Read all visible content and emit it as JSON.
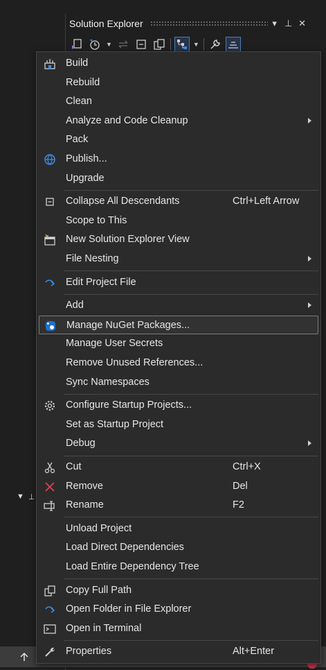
{
  "solution_explorer": {
    "title": "Solution Explorer",
    "controls": [
      "▾",
      "⊥",
      "✕"
    ]
  },
  "context_menu": {
    "groups": [
      [
        {
          "label": "Build",
          "icon": "build-icon",
          "shortcut": "",
          "submenu": false
        },
        {
          "label": "Rebuild",
          "icon": "",
          "shortcut": "",
          "submenu": false
        },
        {
          "label": "Clean",
          "icon": "",
          "shortcut": "",
          "submenu": false
        },
        {
          "label": "Analyze and Code Cleanup",
          "icon": "",
          "shortcut": "",
          "submenu": true
        },
        {
          "label": "Pack",
          "icon": "",
          "shortcut": "",
          "submenu": false
        },
        {
          "label": "Publish...",
          "icon": "globe-icon",
          "shortcut": "",
          "submenu": false
        },
        {
          "label": "Upgrade",
          "icon": "",
          "shortcut": "",
          "submenu": false
        }
      ],
      [
        {
          "label": "Collapse All Descendants",
          "icon": "collapse-icon",
          "shortcut": "Ctrl+Left Arrow",
          "submenu": false
        },
        {
          "label": "Scope to This",
          "icon": "",
          "shortcut": "",
          "submenu": false
        },
        {
          "label": "New Solution Explorer View",
          "icon": "new-view-icon",
          "shortcut": "",
          "submenu": false
        },
        {
          "label": "File Nesting",
          "icon": "",
          "shortcut": "",
          "submenu": true
        }
      ],
      [
        {
          "label": "Edit Project File",
          "icon": "redo-arrow-icon",
          "shortcut": "",
          "submenu": false
        }
      ],
      [
        {
          "label": "Add",
          "icon": "",
          "shortcut": "",
          "submenu": true
        },
        {
          "label": "Manage NuGet Packages...",
          "icon": "nuget-icon",
          "shortcut": "",
          "submenu": false,
          "highlighted": true
        },
        {
          "label": "Manage User Secrets",
          "icon": "",
          "shortcut": "",
          "submenu": false
        },
        {
          "label": "Remove Unused References...",
          "icon": "",
          "shortcut": "",
          "submenu": false
        },
        {
          "label": "Sync Namespaces",
          "icon": "",
          "shortcut": "",
          "submenu": false
        }
      ],
      [
        {
          "label": "Configure Startup Projects...",
          "icon": "gear-icon",
          "shortcut": "",
          "submenu": false
        },
        {
          "label": "Set as Startup Project",
          "icon": "",
          "shortcut": "",
          "submenu": false
        },
        {
          "label": "Debug",
          "icon": "",
          "shortcut": "",
          "submenu": true
        }
      ],
      [
        {
          "label": "Cut",
          "icon": "scissors-icon",
          "shortcut": "Ctrl+X",
          "submenu": false
        },
        {
          "label": "Remove",
          "icon": "close-icon",
          "shortcut": "Del",
          "submenu": false
        },
        {
          "label": "Rename",
          "icon": "rename-icon",
          "shortcut": "F2",
          "submenu": false
        }
      ],
      [
        {
          "label": "Unload Project",
          "icon": "",
          "shortcut": "",
          "submenu": false
        },
        {
          "label": "Load Direct Dependencies",
          "icon": "",
          "shortcut": "",
          "submenu": false
        },
        {
          "label": "Load Entire Dependency Tree",
          "icon": "",
          "shortcut": "",
          "submenu": false
        }
      ],
      [
        {
          "label": "Copy Full Path",
          "icon": "copy-icon",
          "shortcut": "",
          "submenu": false
        },
        {
          "label": "Open Folder in File Explorer",
          "icon": "redo-arrow-icon",
          "shortcut": "",
          "submenu": false
        },
        {
          "label": "Open in Terminal",
          "icon": "terminal-icon",
          "shortcut": "",
          "submenu": false
        }
      ],
      [
        {
          "label": "Properties",
          "icon": "wrench-icon",
          "shortcut": "Alt+Enter",
          "submenu": false
        }
      ]
    ]
  },
  "colors": {
    "menu_bg": "#2b2b2b",
    "highlight_border": "#7a7a7a",
    "icon_blue": "#3c8ee6",
    "icon_red": "#e0424e"
  }
}
